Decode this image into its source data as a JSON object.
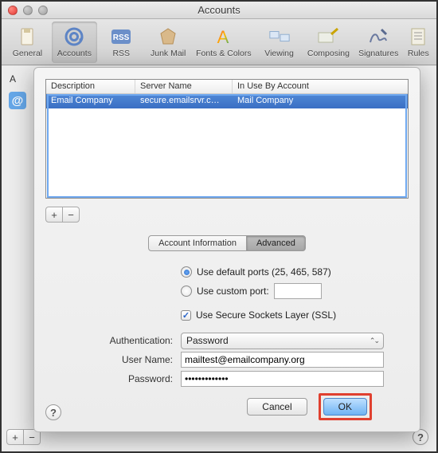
{
  "window": {
    "title": "Accounts"
  },
  "toolbar": {
    "items": [
      {
        "label": "General"
      },
      {
        "label": "Accounts"
      },
      {
        "label": "RSS"
      },
      {
        "label": "Junk Mail"
      },
      {
        "label": "Fonts & Colors"
      },
      {
        "label": "Viewing"
      },
      {
        "label": "Composing"
      },
      {
        "label": "Signatures"
      },
      {
        "label": "Rules"
      }
    ]
  },
  "left": {
    "a": "A"
  },
  "table": {
    "columns": [
      "Description",
      "Server Name",
      "In Use By Account"
    ],
    "rows": [
      {
        "description": "Email Company",
        "server": "secure.emailsrvr.c…",
        "inuse": "Mail Company"
      }
    ]
  },
  "tabs": {
    "left": "Account Information",
    "right": "Advanced"
  },
  "form": {
    "ports_default_label": "Use default ports (25, 465, 587)",
    "ports_custom_label": "Use custom port:",
    "custom_port_value": "",
    "ssl_label": "Use Secure Sockets Layer (SSL)",
    "auth_label": "Authentication:",
    "auth_value": "Password",
    "user_label": "User Name:",
    "user_value": "mailtest@emailcompany.org",
    "pass_label": "Password:",
    "pass_value": "•••••••••••••"
  },
  "buttons": {
    "cancel": "Cancel",
    "ok": "OK"
  },
  "glyphs": {
    "plus": "+",
    "minus": "−",
    "help": "?",
    "check": "✓",
    "arrows": "⌃⌄"
  }
}
